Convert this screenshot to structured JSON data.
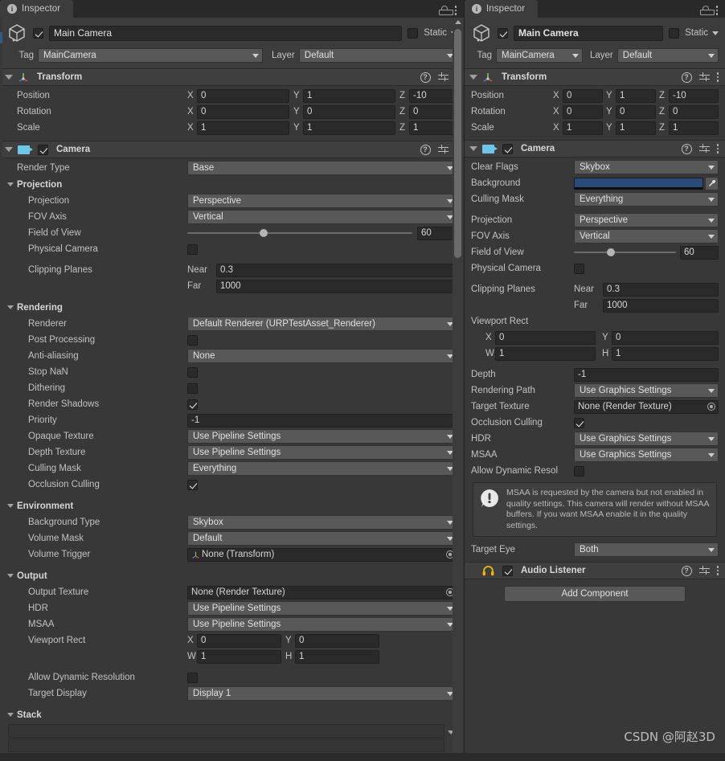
{
  "tab": {
    "title": "Inspector",
    "icon": "info-icon",
    "lock_icon": "lock-icon",
    "menu_icon": "kebab-menu-icon"
  },
  "object": {
    "name": "Main Camera",
    "enabled": true,
    "static_label": "Static",
    "tag_label": "Tag",
    "tag_value": "MainCamera",
    "layer_label": "Layer",
    "layer_value": "Default"
  },
  "transform": {
    "title": "Transform",
    "position_label": "Position",
    "rotation_label": "Rotation",
    "scale_label": "Scale",
    "axis_x": "X",
    "axis_y": "Y",
    "axis_z": "Z",
    "position": {
      "x": "0",
      "y": "1",
      "z": "-10"
    },
    "rotation": {
      "x": "0",
      "y": "0",
      "z": "0"
    },
    "scale": {
      "x": "1",
      "y": "1",
      "z": "1"
    }
  },
  "left_camera": {
    "title": "Camera",
    "enabled": true,
    "render_type_label": "Render Type",
    "render_type_value": "Base",
    "projection_group": "Projection",
    "projection_label": "Projection",
    "projection_value": "Perspective",
    "fov_axis_label": "FOV Axis",
    "fov_axis_value": "Vertical",
    "field_of_view_label": "Field of View",
    "field_of_view_value": "60",
    "physical_camera_label": "Physical Camera",
    "physical_camera_checked": false,
    "clipping_planes_label": "Clipping Planes",
    "near_label": "Near",
    "near_value": "0.3",
    "far_label": "Far",
    "far_value": "1000",
    "rendering_group": "Rendering",
    "renderer_label": "Renderer",
    "renderer_value": "Default Renderer (URPTestAsset_Renderer)",
    "post_processing_label": "Post Processing",
    "post_processing_checked": false,
    "anti_aliasing_label": "Anti-aliasing",
    "anti_aliasing_value": "None",
    "stop_nan_label": "Stop NaN",
    "stop_nan_checked": false,
    "dithering_label": "Dithering",
    "dithering_checked": false,
    "render_shadows_label": "Render Shadows",
    "render_shadows_checked": true,
    "priority_label": "Priority",
    "priority_value": "-1",
    "opaque_texture_label": "Opaque Texture",
    "opaque_texture_value": "Use Pipeline Settings",
    "depth_texture_label": "Depth Texture",
    "depth_texture_value": "Use Pipeline Settings",
    "culling_mask_label": "Culling Mask",
    "culling_mask_value": "Everything",
    "occlusion_culling_label": "Occlusion Culling",
    "occlusion_culling_checked": true,
    "environment_group": "Environment",
    "background_type_label": "Background Type",
    "background_type_value": "Skybox",
    "volume_mask_label": "Volume Mask",
    "volume_mask_value": "Default",
    "volume_trigger_label": "Volume Trigger",
    "volume_trigger_value": "None (Transform)",
    "output_group": "Output",
    "output_texture_label": "Output Texture",
    "output_texture_value": "None (Render Texture)",
    "hdr_label": "HDR",
    "hdr_value": "Use Pipeline Settings",
    "msaa_label": "MSAA",
    "msaa_value": "Use Pipeline Settings",
    "viewport_rect_label": "Viewport Rect",
    "viewport_x_label": "X",
    "viewport_x": "0",
    "viewport_y_label": "Y",
    "viewport_y": "0",
    "viewport_w_label": "W",
    "viewport_w": "1",
    "viewport_h_label": "H",
    "viewport_h": "1",
    "allow_dynamic_resolution_label": "Allow Dynamic Resolution",
    "allow_dynamic_resolution_checked": false,
    "target_display_label": "Target Display",
    "target_display_value": "Display 1",
    "stack_group": "Stack"
  },
  "right_camera": {
    "title": "Camera",
    "enabled": true,
    "clear_flags_label": "Clear Flags",
    "clear_flags_value": "Skybox",
    "background_label": "Background",
    "background_color": "#2a4b77",
    "culling_mask_label": "Culling Mask",
    "culling_mask_value": "Everything",
    "projection_label": "Projection",
    "projection_value": "Perspective",
    "fov_axis_label": "FOV Axis",
    "fov_axis_value": "Vertical",
    "field_of_view_label": "Field of View",
    "field_of_view_value": "60",
    "physical_camera_label": "Physical Camera",
    "physical_camera_checked": false,
    "clipping_planes_label": "Clipping Planes",
    "near_label": "Near",
    "near_value": "0.3",
    "far_label": "Far",
    "far_value": "1000",
    "viewport_rect_label": "Viewport Rect",
    "viewport_x_label": "X",
    "viewport_x": "0",
    "viewport_y_label": "Y",
    "viewport_y": "0",
    "viewport_w_label": "W",
    "viewport_w": "1",
    "viewport_h_label": "H",
    "viewport_h": "1",
    "depth_label": "Depth",
    "depth_value": "-1",
    "rendering_path_label": "Rendering Path",
    "rendering_path_value": "Use Graphics Settings",
    "target_texture_label": "Target Texture",
    "target_texture_value": "None (Render Texture)",
    "occlusion_culling_label": "Occlusion Culling",
    "occlusion_culling_checked": true,
    "hdr_label": "HDR",
    "hdr_value": "Use Graphics Settings",
    "msaa_label": "MSAA",
    "msaa_value": "Use Graphics Settings",
    "allow_dynamic_resolution_label": "Allow Dynamic Resol",
    "allow_dynamic_resolution_checked": false,
    "warning_text": "MSAA is requested by the camera but not enabled in quality settings. This camera will render without MSAA buffers. If you want MSAA enable it in the quality settings.",
    "target_eye_label": "Target Eye",
    "target_eye_value": "Both"
  },
  "audio_listener": {
    "title": "Audio Listener",
    "enabled": true
  },
  "add_component_label": "Add Component",
  "watermark": "CSDN @阿赵3D"
}
